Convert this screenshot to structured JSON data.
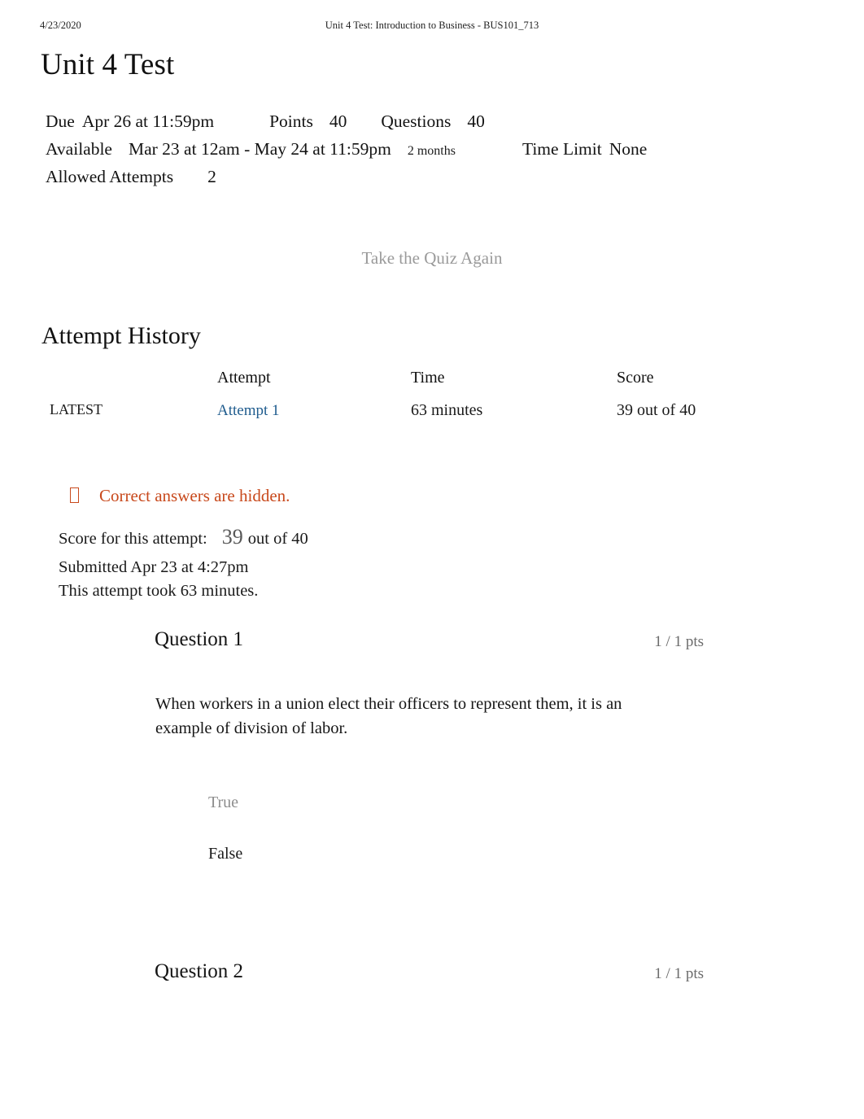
{
  "print_header": {
    "date": "4/23/2020",
    "document_title": "Unit 4 Test: Introduction to Business - BUS101_713"
  },
  "page_title": "Unit 4 Test",
  "quiz_meta": {
    "due_label": "Due",
    "due_value": "Apr 26 at 11:59pm",
    "points_label": "Points",
    "points_value": "40",
    "questions_label": "Questions",
    "questions_value": "40",
    "available_label": "Available",
    "available_value": "Mar 23 at 12am - May 24 at 11:59pm",
    "available_duration": "2 months",
    "time_limit_label": "Time Limit",
    "time_limit_value": "None",
    "allowed_attempts_label": "Allowed Attempts",
    "allowed_attempts_value": "2"
  },
  "take_again_label": "Take the Quiz Again",
  "attempt_history": {
    "title": "Attempt History",
    "columns": {
      "latest": "",
      "attempt": "Attempt",
      "time": "Time",
      "score": "Score"
    },
    "rows": [
      {
        "latest": "LATEST",
        "attempt": "Attempt 1",
        "time": "63 minutes",
        "score": "39 out of 40"
      }
    ]
  },
  "hidden_notice": {
    "icon": "missing-glyph-box-icon",
    "text": "Correct answers are hidden.",
    "color": "#c8491c"
  },
  "attempt_summary": {
    "score_label": "Score for this attempt:",
    "score_value": "39",
    "score_outof": "out of 40",
    "submitted": "Submitted Apr 23 at 4:27pm",
    "duration": "This attempt took 63 minutes."
  },
  "questions": [
    {
      "name": "Question 1",
      "points": "1 / 1 pts",
      "text": "When workers in a union elect their officers to represent them, it is an example of division of labor.",
      "answers": [
        {
          "label": "True",
          "state": "unselected"
        },
        {
          "label": "False",
          "state": "selected"
        }
      ]
    },
    {
      "name": "Question 2",
      "points": "1 / 1 pts",
      "text": "",
      "answers": []
    }
  ],
  "colors": {
    "link": "#1f5c8e",
    "notice": "#c8491c",
    "muted": "#8e8e8e",
    "pts": "#6b6b6b",
    "score_big": "#595959"
  }
}
